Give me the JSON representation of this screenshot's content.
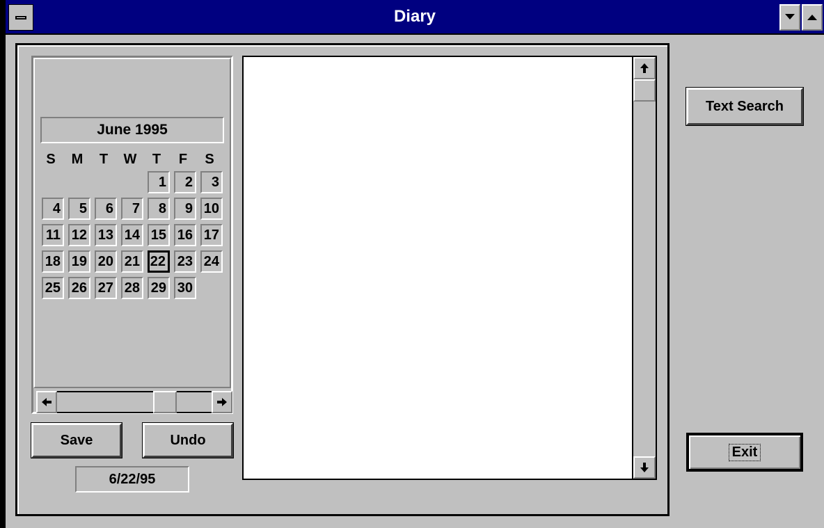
{
  "window": {
    "title": "Diary",
    "icons": {
      "system_menu": "system-menu-icon",
      "minimize": "minimize-arrow-icon",
      "maximize": "maximize-arrow-icon"
    }
  },
  "calendar": {
    "month_label": "June 1995",
    "weekdays": [
      "S",
      "M",
      "T",
      "W",
      "T",
      "F",
      "S"
    ],
    "selected_day": "22",
    "weeks": [
      [
        "",
        "",
        "",
        "",
        "1",
        "2",
        "3"
      ],
      [
        "4",
        "5",
        "6",
        "7",
        "8",
        "9",
        "10"
      ],
      [
        "11",
        "12",
        "13",
        "14",
        "15",
        "16",
        "17"
      ],
      [
        "18",
        "19",
        "20",
        "21",
        "22",
        "23",
        "24"
      ],
      [
        "25",
        "26",
        "27",
        "28",
        "29",
        "30",
        ""
      ]
    ]
  },
  "buttons": {
    "save": "Save",
    "undo": "Undo",
    "text_search": "Text Search",
    "exit": "Exit"
  },
  "date_field": "6/22/95",
  "diary_text": "",
  "colors": {
    "title_bar": "#000080",
    "face": "#c0c0c0",
    "text_area": "#ffffff"
  }
}
